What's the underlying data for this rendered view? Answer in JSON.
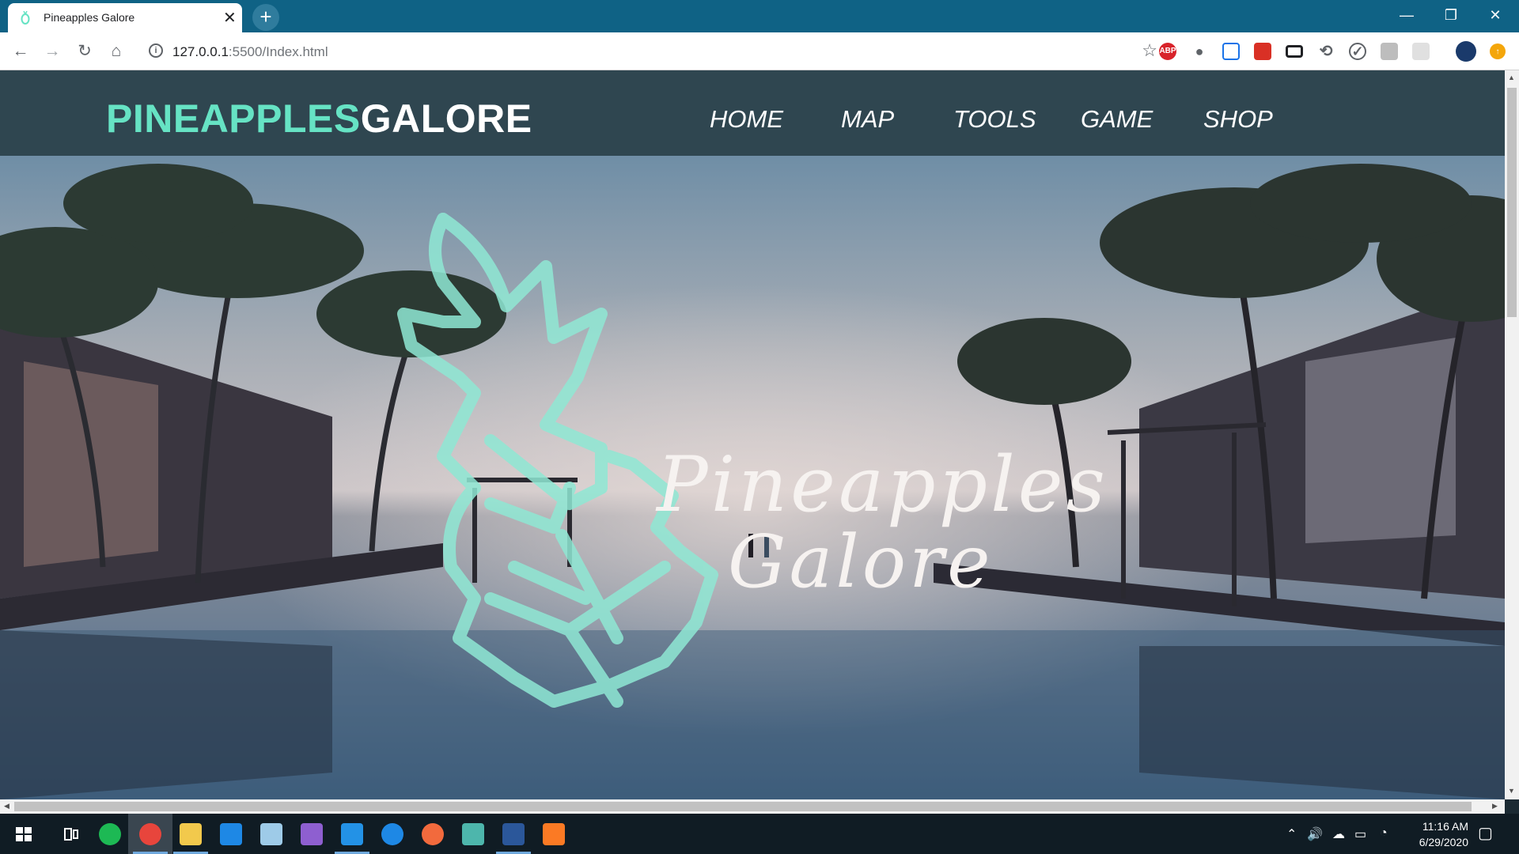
{
  "browser": {
    "tab_title": "Pineapples Galore",
    "url_host": "127.0.0.1",
    "url_rest": ":5500/Index.html",
    "new_tab_icon": "plus-icon",
    "window_controls": [
      "minimize-icon",
      "restore-icon",
      "close-icon"
    ],
    "nav_icons": [
      "back-arrow-icon",
      "forward-arrow-icon",
      "reload-icon",
      "home-icon"
    ],
    "extensions": [
      {
        "name": "adblock-plus-icon",
        "label": "ABP",
        "color": "#d8232a"
      },
      {
        "name": "lightbulb-icon",
        "label": "",
        "color": "#5f6368"
      },
      {
        "name": "capture-icon",
        "label": "",
        "color": "#1a73e8"
      },
      {
        "name": "bookmark-red-icon",
        "label": "",
        "color": "#d93025"
      },
      {
        "name": "fullscreen-icon",
        "label": "",
        "color": "#202124"
      },
      {
        "name": "sync-icon",
        "label": "",
        "color": "#5f6368"
      },
      {
        "name": "check-icon",
        "label": "",
        "color": "#5f6368"
      },
      {
        "name": "extension-gray-icon",
        "label": "",
        "color": "#bdbdbd"
      },
      {
        "name": "extension-light-icon",
        "label": "",
        "color": "#e0e0e0"
      }
    ]
  },
  "site": {
    "brand_part1": "PINEAPPLES",
    "brand_part2": "GALORE",
    "nav": [
      "HOME",
      "MAP",
      "TOOLS",
      "GAME",
      "SHOP"
    ],
    "hero_line1": "Pineapples",
    "hero_line2": "Galore",
    "brand_accent": "#66e3c4",
    "nav_bg": "#2f4650"
  },
  "taskbar": {
    "apps": [
      {
        "name": "spotify-icon",
        "color": "#1db954",
        "active": false
      },
      {
        "name": "chrome-icon",
        "color": "#e8453c",
        "active": true
      },
      {
        "name": "file-explorer-icon",
        "color": "#f2c94c",
        "active": false
      },
      {
        "name": "edge-icon",
        "color": "#1e88e5",
        "active": false
      },
      {
        "name": "cube-app-icon",
        "color": "#9ecbe8",
        "active": false
      },
      {
        "name": "visual-studio-icon",
        "color": "#8e5fd0",
        "active": false
      },
      {
        "name": "vscode-icon",
        "color": "#2392e6",
        "active": false
      },
      {
        "name": "maps-pin-icon",
        "color": "#1e88e5",
        "active": false
      },
      {
        "name": "compass-app-icon",
        "color": "#f26a3d",
        "active": false
      },
      {
        "name": "terminal-app-icon",
        "color": "#4db6ac",
        "active": false
      },
      {
        "name": "word-icon",
        "color": "#2b579a",
        "active": false
      },
      {
        "name": "xampp-icon",
        "color": "#fb7a24",
        "active": false
      }
    ],
    "time": "11:16 AM",
    "date": "6/29/2020"
  }
}
